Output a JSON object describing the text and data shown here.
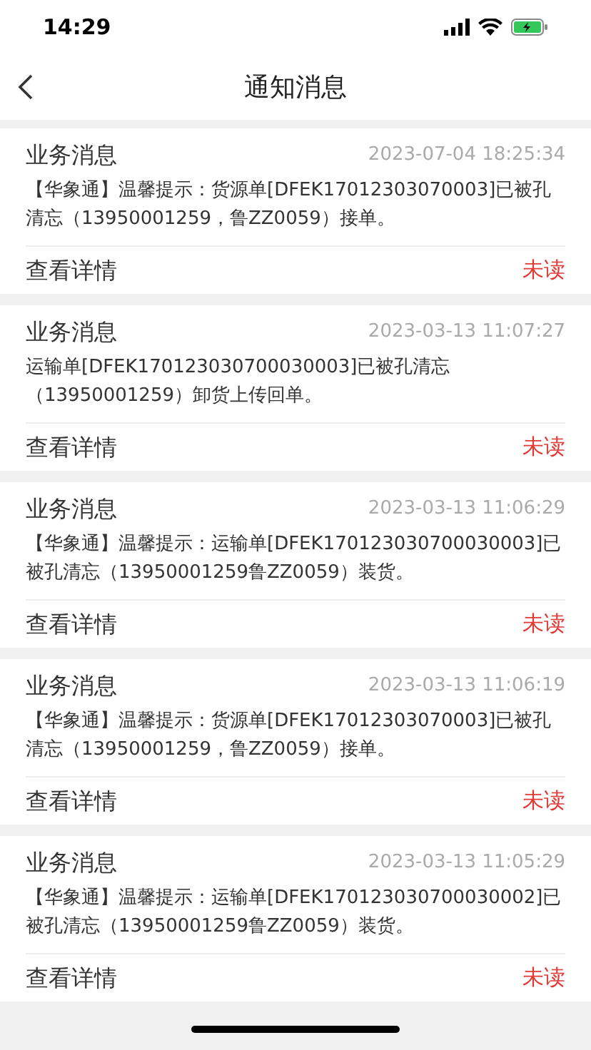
{
  "status_bar": {
    "time": "14:29"
  },
  "nav": {
    "title": "通知消息"
  },
  "messages": [
    {
      "category": "业务消息",
      "time": "2023-07-04 18:25:34",
      "body": "【华象通】温馨提示：货源单[DFEK17012303070003]已被孔清忘（13950001259，鲁ZZ0059）接单。",
      "action": "查看详情",
      "status": "未读",
      "read": false
    },
    {
      "category": "业务消息",
      "time": "2023-03-13 11:07:27",
      "body": "运输单[DFEK170123030700030003]已被孔清忘（13950001259）卸货上传回单。",
      "action": "查看详情",
      "status": "未读",
      "read": false
    },
    {
      "category": "业务消息",
      "time": "2023-03-13 11:06:29",
      "body": "【华象通】温馨提示：运输单[DFEK170123030700030003]已被孔清忘（13950001259鲁ZZ0059）装货。",
      "action": "查看详情",
      "status": "未读",
      "read": false
    },
    {
      "category": "业务消息",
      "time": "2023-03-13 11:06:19",
      "body": "【华象通】温馨提示：货源单[DFEK17012303070003]已被孔清忘（13950001259，鲁ZZ0059）接单。",
      "action": "查看详情",
      "status": "未读",
      "read": false
    },
    {
      "category": "业务消息",
      "time": "2023-03-13 11:05:29",
      "body": "【华象通】温馨提示：运输单[DFEK170123030700030002]已被孔清忘（13950001259鲁ZZ0059）装货。",
      "action": "查看详情",
      "status": "未读",
      "read": false
    }
  ]
}
